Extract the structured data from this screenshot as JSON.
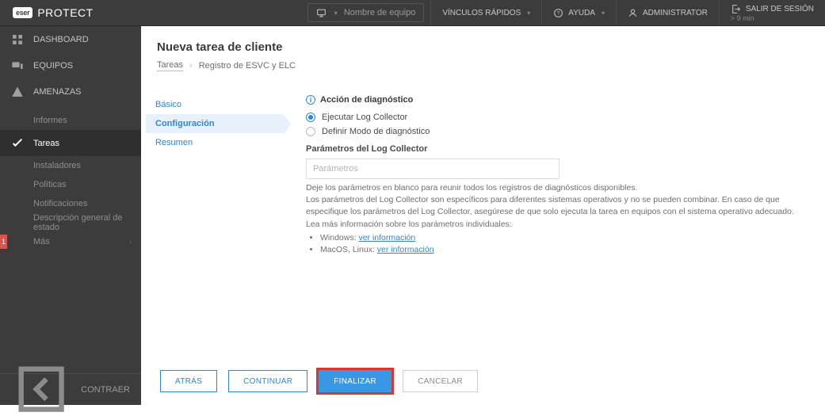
{
  "brand": {
    "badge": "eser",
    "name": "PROTECT"
  },
  "topbar": {
    "search_placeholder": "Nombre de equipo",
    "quicklinks": "VÍNCULOS RÁPIDOS",
    "help": "AYUDA",
    "user": "ADMINISTRATOR",
    "logout": "SALIR DE SESIÓN",
    "logout_sub": "> 9 min"
  },
  "sidebar": {
    "dashboard": "DASHBOARD",
    "equipos": "EQUIPOS",
    "amenazas": "AMENAZAS",
    "informes": "Informes",
    "tareas": "Tareas",
    "instaladores": "Instaladores",
    "politicas": "Políticas",
    "notificaciones": "Notificaciones",
    "estado": "Descripción general de estado",
    "mas": "Más",
    "mas_badge": "1",
    "collapse": "CONTRAER"
  },
  "page": {
    "title": "Nueva tarea de cliente",
    "bc1": "Tareas",
    "bc2": "Registro de ESVC y ELC"
  },
  "steps": {
    "basico": "Básico",
    "config": "Configuración",
    "resumen": "Resumen"
  },
  "form": {
    "section": "Acción de diagnóstico",
    "opt_run": "Ejecutar Log Collector",
    "opt_def": "Definir Modo de diagnóstico",
    "params_h": "Parámetros del Log Collector",
    "params_ph": "Parámetros",
    "help_l1": "Deje los parámetros en blanco para reunir todos los registros de diagnósticos disponibles.",
    "help_l2": "Los parámetros del Log Collector son específicos para diferentes sistemas operativos y no se pueden combinar. En caso de que especifique los parámetros del Log Collector, asegúrese de que solo ejecuta la tarea en equipos con el sistema operativo adecuado.",
    "help_l3": "Lea más información sobre los parámetros individuales:",
    "li_win_pre": "Windows: ",
    "li_mac_pre": "MacOS, Linux: ",
    "link": "ver información"
  },
  "footer": {
    "back": "ATRÁS",
    "continue": "CONTINUAR",
    "finish": "FINALIZAR",
    "cancel": "CANCELAR"
  }
}
